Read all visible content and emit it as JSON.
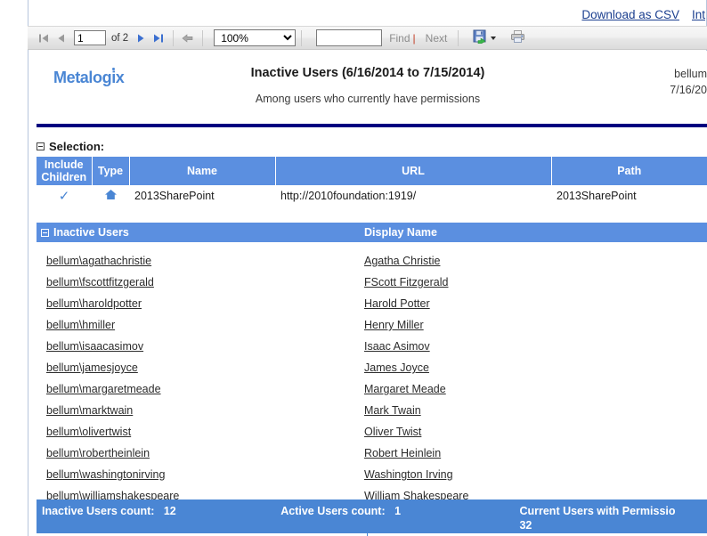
{
  "toplinks": [
    {
      "label": "Download as CSV",
      "name": "download-as-csv-link"
    },
    {
      "label": "Int",
      "name": "integration-link-truncated"
    }
  ],
  "toolbar": {
    "page_value": "1",
    "of_pages": "of 2",
    "zoom_value": "100%",
    "find_value": "",
    "find_label": "Find",
    "find_separator": "|",
    "next_label": "Next",
    "first_page_title": "First Page",
    "prev_page_title": "Previous Page",
    "next_page_title": "Next Page",
    "last_page_title": "Last Page",
    "back_title": "Back to Parent Report",
    "export_title": "Export",
    "print_title": "Print"
  },
  "report": {
    "logo": "Metalogix",
    "title": "Inactive Users (6/16/2014 to 7/15/2014)",
    "subtitle": "Among users who currently have permissions",
    "meta_user": "bellum",
    "meta_date": "7/16/20"
  },
  "selection": {
    "section_label": "Selection:",
    "columns": [
      "Include Children",
      "Type",
      "Name",
      "URL",
      "Path"
    ],
    "rows": [
      {
        "include_children": "✓",
        "type_icon": "home-icon",
        "name": "2013SharePoint",
        "url": "http://2010foundation:1919/",
        "path": "2013SharePoint"
      }
    ]
  },
  "inactive_users": {
    "section_label": "Inactive Users",
    "display_name_header": "Display Name",
    "rows": [
      {
        "account": "bellum\\agathachristie",
        "display_name": "Agatha Christie"
      },
      {
        "account": "bellum\\fscottfitzgerald",
        "display_name": "FScott Fitzgerald"
      },
      {
        "account": "bellum\\haroldpotter",
        "display_name": "Harold Potter"
      },
      {
        "account": "bellum\\hmiller",
        "display_name": "Henry Miller"
      },
      {
        "account": "bellum\\isaacasimov",
        "display_name": "Isaac Asimov"
      },
      {
        "account": "bellum\\jamesjoyce",
        "display_name": "James Joyce"
      },
      {
        "account": "bellum\\margaretmeade",
        "display_name": "Margaret Meade"
      },
      {
        "account": "bellum\\marktwain",
        "display_name": "Mark Twain"
      },
      {
        "account": "bellum\\olivertwist",
        "display_name": "Oliver Twist"
      },
      {
        "account": "bellum\\robertheinlein",
        "display_name": "Robert Heinlein"
      },
      {
        "account": "bellum\\washingtonirving",
        "display_name": "Washington Irving"
      },
      {
        "account": "bellum\\williamshakespeare",
        "display_name": "William Shakespeare"
      }
    ]
  },
  "summary": {
    "inactive_label": "Inactive Users count:",
    "inactive_count": "12",
    "active_label": "Active Users count:",
    "active_count": "1",
    "permissions_label": "Current Users with Permissio",
    "permissions_count": "32"
  },
  "colors": {
    "navy_rule": "#000080",
    "table_header_blue": "#5b8fe0",
    "summary_blue": "#4a86d4",
    "logo_blue": "#4a86d4",
    "url_red": "#a23a2a",
    "link_blue": "#1b3f8f"
  }
}
